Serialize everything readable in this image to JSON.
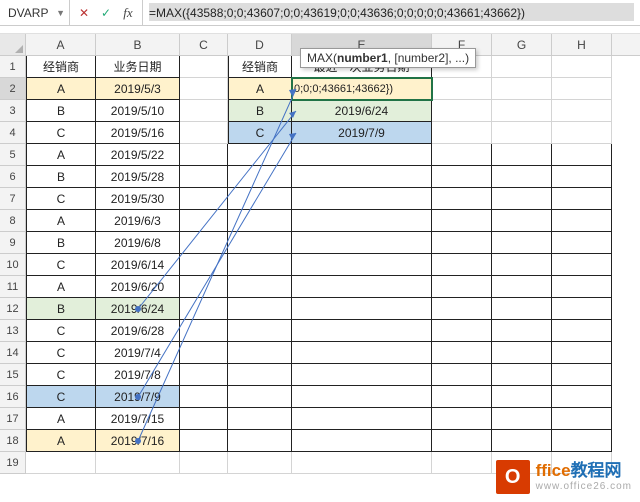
{
  "namebox": "DVARP",
  "formula": "=MAX({43588;0;0;43607;0;0;43619;0;0;43636;0;0;0;0;0;43661;43662})",
  "tooltip_fn": "MAX",
  "tooltip_arg1": "number1",
  "tooltip_rest": ", [number2], ...)",
  "cols": [
    "A",
    "B",
    "C",
    "D",
    "E",
    "F",
    "G",
    "H"
  ],
  "rows": [
    "1",
    "2",
    "3",
    "4",
    "5",
    "6",
    "7",
    "8",
    "9",
    "10",
    "11",
    "12",
    "13",
    "14",
    "15",
    "16",
    "17",
    "18",
    "19"
  ],
  "hdrA": "经销商",
  "hdrB": "业务日期",
  "hdrD": "经销商",
  "hdrE": "最近一次业务日期",
  "ab": [
    {
      "a": "A",
      "b": "2019/5/3"
    },
    {
      "a": "B",
      "b": "2019/5/10"
    },
    {
      "a": "C",
      "b": "2019/5/16"
    },
    {
      "a": "A",
      "b": "2019/5/22"
    },
    {
      "a": "B",
      "b": "2019/5/28"
    },
    {
      "a": "C",
      "b": "2019/5/30"
    },
    {
      "a": "A",
      "b": "2019/6/3"
    },
    {
      "a": "B",
      "b": "2019/6/8"
    },
    {
      "a": "C",
      "b": "2019/6/14"
    },
    {
      "a": "A",
      "b": "2019/6/20"
    },
    {
      "a": "B",
      "b": "2019/6/24"
    },
    {
      "a": "C",
      "b": "2019/6/28"
    },
    {
      "a": "C",
      "b": "2019/7/4"
    },
    {
      "a": "C",
      "b": "2019/7/8"
    },
    {
      "a": "C",
      "b": "2019/7/9"
    },
    {
      "a": "A",
      "b": "2019/7/15"
    },
    {
      "a": "A",
      "b": "2019/7/16"
    }
  ],
  "de": [
    {
      "d": "A",
      "e": "0;0;0;43661;43662})"
    },
    {
      "d": "B",
      "e": "2019/6/24"
    },
    {
      "d": "C",
      "e": "2019/7/9"
    }
  ],
  "logo": {
    "ch": "O",
    "line1a": "ffice",
    "line1b": "教程网",
    "line2": "www.office26.com"
  }
}
